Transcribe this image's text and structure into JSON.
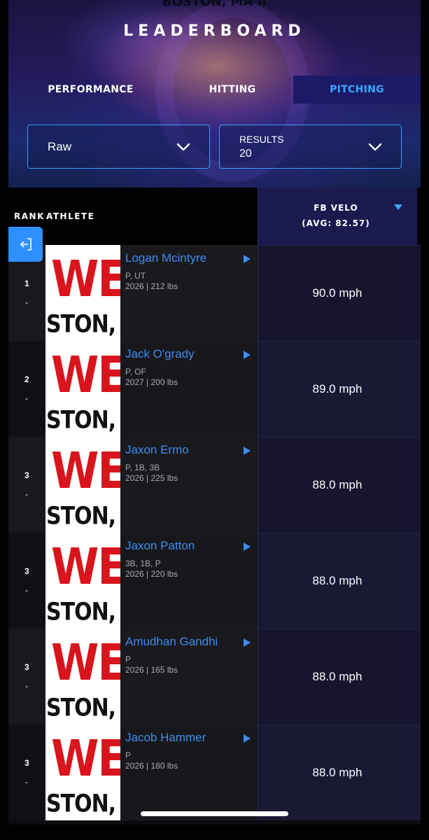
{
  "header": {
    "location": "BOSTON, MA II",
    "title": "LEADERBOARD"
  },
  "tabs": [
    {
      "label": "PERFORMANCE",
      "active": false
    },
    {
      "label": "HITTING",
      "active": false
    },
    {
      "label": "PITCHING",
      "active": true
    }
  ],
  "filters": {
    "mode": {
      "value": "Raw"
    },
    "results": {
      "label": "RESULTS",
      "value": "20"
    }
  },
  "table": {
    "rank_header": "RANK",
    "athlete_header": "ATHLETE",
    "metric_header": "FB VELO",
    "metric_avg": "(AVG: 82.57)",
    "rows": [
      {
        "rank": "1",
        "change": "-",
        "name": "Logan Mcintyre",
        "positions": "P, UT",
        "meta": "2026 | 212 lbs",
        "value": "90.0 mph"
      },
      {
        "rank": "2",
        "change": "-",
        "name": "Jack O'grady",
        "positions": "P, OF",
        "meta": "2027 | 200 lbs",
        "value": "89.0 mph"
      },
      {
        "rank": "3",
        "change": "-",
        "name": "Jaxon Ermo",
        "positions": "P, 1B, 3B",
        "meta": "2026 | 225 lbs",
        "value": "88.0 mph"
      },
      {
        "rank": "3",
        "change": "-",
        "name": "Jaxon Patton",
        "positions": "3B, 1B, P",
        "meta": "2026 | 220 lbs",
        "value": "88.0 mph"
      },
      {
        "rank": "3",
        "change": "-",
        "name": "Amudhan Gandhi",
        "positions": "P",
        "meta": "2026 | 165 lbs",
        "value": "88.0 mph"
      },
      {
        "rank": "3",
        "change": "-",
        "name": "Jacob Hammer",
        "positions": "P",
        "meta": "2026 | 180 lbs",
        "value": "88.0 mph"
      }
    ]
  },
  "photo_placeholder": {
    "line1": "WE",
    "line2": "STON, MA"
  },
  "colors": {
    "accent": "#3b9bff",
    "active_tab_bg": "#1b1a66",
    "name_link": "#3d8cf0"
  },
  "icons": {
    "dropdown": "chevron-down-icon",
    "exit": "exit-icon",
    "sort": "sort-down-icon",
    "play": "play-icon"
  }
}
